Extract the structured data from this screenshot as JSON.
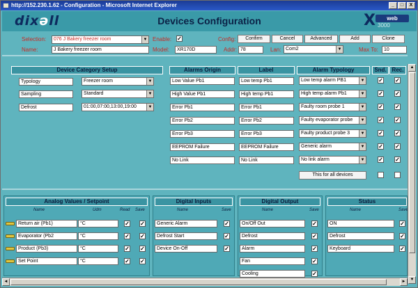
{
  "window": {
    "title": "http://152.230.1.62 - Configuration - Microsoft Internet Explorer",
    "min": "_",
    "max": "□",
    "close": "X"
  },
  "header": {
    "logo_left": "dix",
    "logo_dot": "ə",
    "logo_right": "ll",
    "title": "Devices Configuration",
    "xweb_x": "X",
    "xweb_w": "web",
    "xweb_s": "3000"
  },
  "config": {
    "selection_label": "Selection:",
    "selection_value": "076 J Bakery freezer room",
    "enable_label": "Enable:",
    "config_label": "Config:",
    "buttons": [
      "Confirm",
      "Cancel",
      "Advanced",
      "Add",
      "Clone"
    ],
    "name_label": "Name:",
    "name_value": "J Bakery freezer room",
    "model_label": "Model:",
    "model_value": "XR170D",
    "addr_label": "Addr:",
    "addr_value": "78",
    "lan_label": "Lan:",
    "lan_value": "Com2",
    "maxto_label": "Max To:",
    "maxto_value": "10"
  },
  "category": {
    "title": "Device Category Setup",
    "rows": [
      {
        "label": "Typology",
        "value": "Freezer room"
      },
      {
        "label": "Sampling",
        "value": "Standard"
      },
      {
        "label": "Defrost",
        "value": "01:00,07:00,13:00,19:00"
      }
    ]
  },
  "alarms": {
    "origin_title": "Alarms Origin",
    "label_title": "Label",
    "typology_title": "Alarm Typology",
    "snd_title": "Snd.",
    "rec_title": "Rec.",
    "rows": [
      {
        "origin": "Low Value Pb1",
        "label": "Low temp Pb1",
        "typ": "Low temp alarm PB1"
      },
      {
        "origin": "High Value Pb1",
        "label": "High temp Pb1",
        "typ": "High temp alarm Pb1"
      },
      {
        "origin": "Error Pb1",
        "label": "Error Pb1",
        "typ": "Faulty room probe 1"
      },
      {
        "origin": "Error Pb2",
        "label": "Error Pb2",
        "typ": "Faulty evaporator probe"
      },
      {
        "origin": "Error Pb3",
        "label": "Error Pb3",
        "typ": "Faulty product probe 3"
      },
      {
        "origin": "EEPROM Failure",
        "label": "EEPROM Failure",
        "typ": "Generic alarm"
      },
      {
        "origin": "No Link",
        "label": "No Link",
        "typ": "No link alarm"
      }
    ],
    "all_button": "This for all devices"
  },
  "analog": {
    "title": "Analog Values / Setpoint",
    "h_name": "Name",
    "h_udm": "Udm",
    "h_read": "Read",
    "h_save": "Save",
    "rows": [
      {
        "name": "Return air (Pb1)",
        "udm": "°C"
      },
      {
        "name": "Evaporator (Pb2",
        "udm": "°C"
      },
      {
        "name": "Product (Pb3)",
        "udm": "°C"
      },
      {
        "name": "Set Point",
        "udm": "°C"
      }
    ]
  },
  "dinputs": {
    "title": "Digital Inputs",
    "h_name": "Name",
    "h_save": "Save",
    "rows": [
      "Generic Alarm",
      "Defrost Start",
      "Device On-Off"
    ]
  },
  "doutput": {
    "title": "Digital Output",
    "h_name": "Name",
    "h_save": "Save",
    "rows": [
      "On/Off Out",
      "Defrost",
      "Alarm",
      "Fan",
      "Cooling"
    ]
  },
  "status": {
    "title": "Status",
    "h_name": "Name",
    "h_save": "Save",
    "rows": [
      "ON",
      "Defrost",
      "Keyboard"
    ]
  },
  "glyphs": {
    "check": "✓",
    "arrow_down": "▼",
    "arrow_up": "▲",
    "arrow_left": "◄",
    "arrow_right": "►"
  }
}
